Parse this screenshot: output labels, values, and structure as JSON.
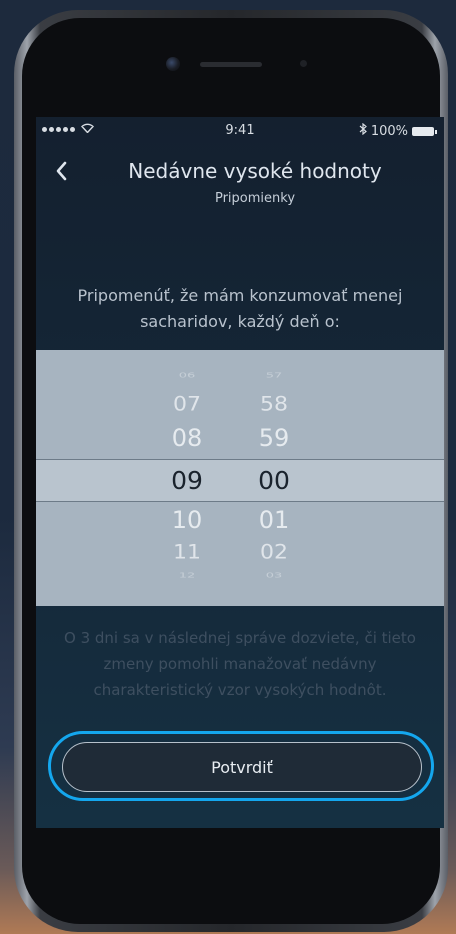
{
  "status_bar": {
    "time": "9:41",
    "battery_text": "100%",
    "icons": [
      "signal-dots-icon",
      "wifi-icon",
      "bluetooth-icon",
      "battery-icon"
    ]
  },
  "header": {
    "title": "Nedávne vysoké hodnoty",
    "subtitle": "Pripomienky",
    "back_icon": "chevron-left-icon"
  },
  "prompt_text": "Pripomenúť, že mám konzumovať menej sacharidov, každý deň o:",
  "time_picker": {
    "hours": [
      "06",
      "07",
      "08",
      "09",
      "10",
      "11",
      "12"
    ],
    "minutes": [
      "57",
      "58",
      "59",
      "00",
      "01",
      "02",
      "03"
    ],
    "selected_hour": "09",
    "selected_minute": "00"
  },
  "info_text": "O 3 dni sa v následnej správe dozviete, či tieto zmeny pomohli manažovať nedávny charakteristický vzor vysokých hodnôt.",
  "confirm_button": {
    "label": "Potvrdiť"
  },
  "colors": {
    "accent": "#14a7ee",
    "screen_bg": "#15293a",
    "picker_bg": "#a7b4c0"
  }
}
